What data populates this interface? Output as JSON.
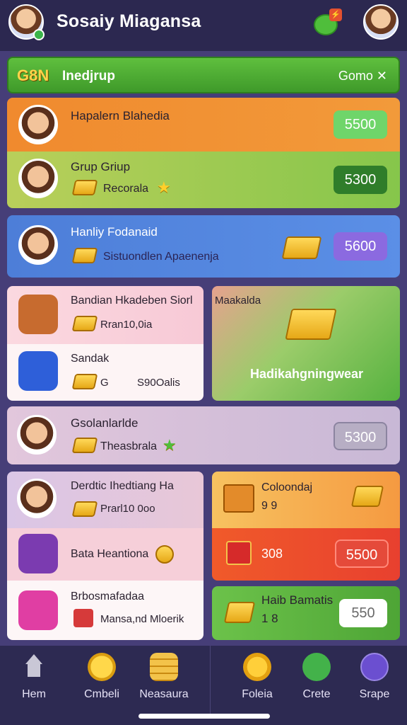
{
  "app": {
    "title": "Sosaiy Miagansa"
  },
  "topbar": {
    "notification_tag": "⚡"
  },
  "header": {
    "logo": "G8N",
    "label": "Inedjrup",
    "right_label": "Gomo",
    "right_icon": "close-x"
  },
  "rows": [
    {
      "name": "Hapalern Blahedia",
      "price": "5500"
    },
    {
      "name": "Grup Griup",
      "sub": "Recorala",
      "price": "5300"
    },
    {
      "name": "Hanliy Fodanaid",
      "sub": "Sistuondlen Apaenenja",
      "price": "5600"
    },
    {
      "name": "Bandian Hkadeben Siorl",
      "sub": "Rran10,0ia"
    },
    {
      "name": "Sandak",
      "sub": "G",
      "sub2": "S90Oalis"
    },
    {
      "name": "Gsolanlarlde",
      "sub": "Theasbrala",
      "price": "5300"
    },
    {
      "name": "Derdtic Ihedtiang Ha",
      "sub": "Prarl10 0oo"
    },
    {
      "name": "Bata Heantiona"
    },
    {
      "name": "Brbosmafadaa",
      "sub": "Mansa,nd Mloerik"
    }
  ],
  "feature": {
    "title": "Maakalda",
    "caption": "Hadikahgningwear"
  },
  "cards": [
    {
      "title": "Coloondaj",
      "value": "9 9"
    },
    {
      "value": "308",
      "price": "5500"
    },
    {
      "title": "Haib Bamatis",
      "value": "1 8",
      "price": "550"
    }
  ],
  "nav": [
    {
      "label": "Hem",
      "icon": "home-icon"
    },
    {
      "label": "Cmbeli",
      "icon": "coin-icon"
    },
    {
      "label": "Neasaura",
      "icon": "coins-stack-icon"
    },
    {
      "label": "Foleia",
      "icon": "cookie-icon"
    },
    {
      "label": "Crete",
      "icon": "leaf-icon"
    },
    {
      "label": "Srape",
      "icon": "share-icon"
    }
  ],
  "colors": {
    "accent_green": "#4fbe3b",
    "accent_purple": "#7d5ad9",
    "panel": "#463e78"
  }
}
